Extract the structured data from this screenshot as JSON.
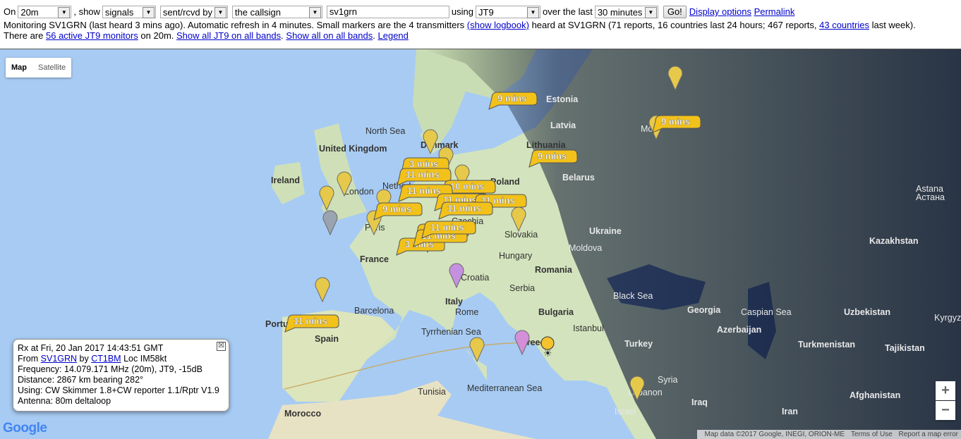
{
  "controls": {
    "on_label": "On",
    "band": "20m",
    "show_label": ", show",
    "show_value": "signals",
    "direction": "sent/rcvd by",
    "target": "the callsign",
    "callsign": "sv1grn",
    "using_label": "using",
    "mode": "JT9",
    "over_label": "over the last",
    "period": "30 minutes",
    "go_label": "Go!",
    "display_options": "Display options",
    "permalink": "Permalink"
  },
  "status": {
    "line1_a": "Monitoring SV1GRN (last heard 3 mins ago). Automatic refresh in 4 minutes. Small markers are the 4 transmitters",
    "show_logbook": "(show logbook)",
    "line1_b": "heard at SV1GRN (71 reports, 16 countries last 24 hours; 467 reports,",
    "countries_link": "43 countries",
    "line1_c": "last week).",
    "line2_a": "There are",
    "monitors_link": "56 active JT9 monitors",
    "line2_b": "on 20m.",
    "all_bands_link": "Show all JT9 on all bands",
    "all_all_link": "Show all on all bands",
    "legend_link": "Legend"
  },
  "map": {
    "type_map": "Map",
    "type_satellite": "Satellite",
    "zoom_in": "+",
    "zoom_out": "−",
    "google": "Google",
    "attrib_data": "Map data ©2017 Google, INEGI, ORION-ME",
    "attrib_terms": "Terms of Use",
    "attrib_report": "Report a map error",
    "places": [
      "Estonia",
      "Latvia",
      "Lithuania",
      "Denmark",
      "North Sea",
      "United Kingdom",
      "Ireland",
      "London",
      "Poland",
      "Belarus",
      "Ukraine",
      "Kazakhstan",
      "Astana",
      "Астана",
      "Moldova",
      "Slovakia",
      "Hungary",
      "Romania",
      "France",
      "Paris",
      "Croatia",
      "Serbia",
      "Italy",
      "Rome",
      "Bulgaria",
      "Black Sea",
      "Georgia",
      "Caspian Sea",
      "Uzbekistan",
      "Kyrgyzs",
      "Azerbaijan",
      "Turkmenistan",
      "Tajikistan",
      "Turkey",
      "Istanbul",
      "Barcelona",
      "Portugal",
      "Spain",
      "Tyrrhenian Sea",
      "Greece",
      "Mediterranean Sea",
      "Tunisia",
      "Syria",
      "Lebanon",
      "Iraq",
      "Israel",
      "Iran",
      "Afghanistan",
      "Morocco",
      "Mo",
      "Netherl",
      "Czechia"
    ],
    "time_labels": [
      "9 mins",
      "9 mins",
      "9 mins",
      "3 mins",
      "11 mins",
      "10 mins",
      "11 mins",
      "11 mins",
      "11 mins",
      "9 mins",
      "11 mins",
      "11 mins",
      "3 mins",
      "11 mins",
      "11 mins",
      "11 mins"
    ],
    "sun_icon": "☀"
  },
  "infobox": {
    "line1": "Rx at Fri, 20 Jan 2017 14:43:51 GMT",
    "from_label": "From",
    "from_call": "SV1GRN",
    "by_label": "by",
    "by_call": "CT1BM",
    "loc": "Loc IM58kt",
    "frequency": "Frequency: 14.079.171 MHz (20m), JT9, -15dB",
    "distance": "Distance: 2867 km bearing 282°",
    "using": "Using: CW Skimmer 1.8+CW reporter 1.1/Rptr V1.9",
    "antenna": "Antenna: 80m deltaloop",
    "close": "☒"
  }
}
